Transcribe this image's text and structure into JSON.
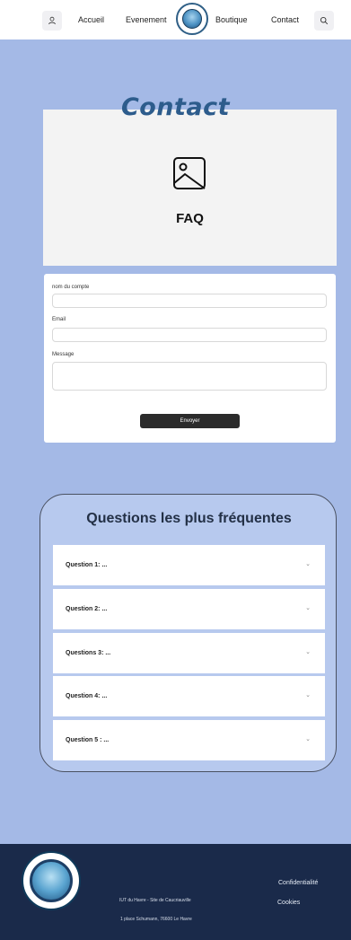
{
  "header": {
    "nav": [
      "Accueil",
      "Evenement",
      "Boutique",
      "Contact"
    ]
  },
  "page": {
    "title": "Contact",
    "faq_label": "FAQ"
  },
  "form": {
    "fields": [
      {
        "label": "nom du compte",
        "value": ""
      },
      {
        "label": "Email",
        "value": ""
      },
      {
        "label": "Message",
        "value": ""
      }
    ],
    "submit_label": "Envoyer"
  },
  "faq_section": {
    "title": "Questions les plus fréquentes",
    "questions": [
      "Question 1: ...",
      "Question 2: ...",
      "Questions 3: ...",
      "Question 4: ...",
      "Question 5 : ..."
    ]
  },
  "footer": {
    "address_line1": "IUT du Havre - Site de Caucriauville",
    "address_line2": "1 place Schumann, 76600 Le Havre",
    "links": [
      "Confidentialité",
      "Cookies"
    ]
  },
  "colors": {
    "main_background": "#a4b9e6",
    "footer_background": "#1a2a4a",
    "title_color": "#2d5c8c",
    "card_background": "#b7c9ee"
  },
  "icons": [
    "user-icon",
    "search-icon",
    "image-placeholder-icon",
    "chevron-down-icon"
  ]
}
